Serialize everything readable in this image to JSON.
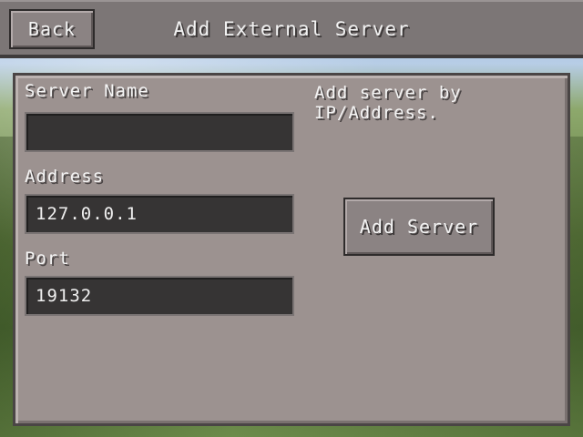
{
  "header": {
    "back_label": "Back",
    "title": "Add External Server"
  },
  "form": {
    "server_name": {
      "label": "Server Name",
      "value": ""
    },
    "address": {
      "label": "Address",
      "value": "127.0.0.1"
    },
    "port": {
      "label": "Port",
      "value": "19132"
    }
  },
  "side": {
    "hint_line1": "Add server by",
    "hint_line2": "IP/Address.",
    "add_server_label": "Add Server"
  }
}
